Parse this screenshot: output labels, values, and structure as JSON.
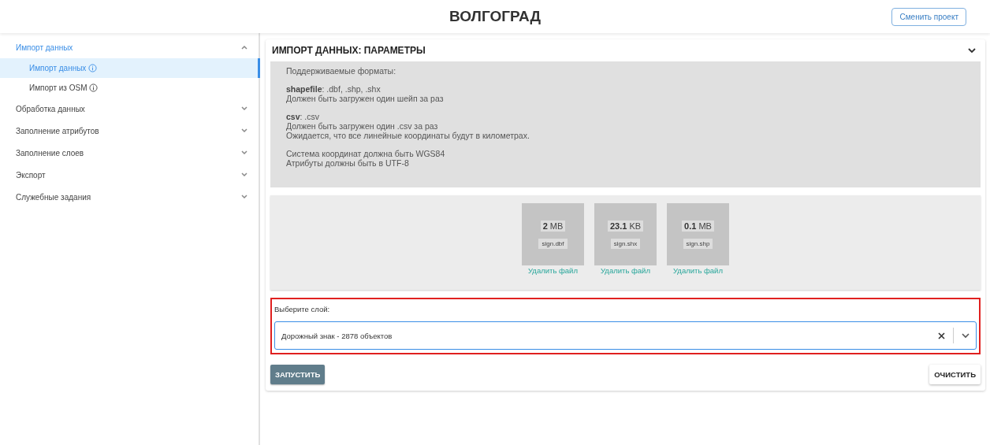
{
  "header": {
    "title": "ВОЛГОГРАД",
    "button": "Сменить проект"
  },
  "sidebar": {
    "groups": [
      {
        "label": "Импорт данных",
        "expanded": true,
        "children": [
          {
            "label": "Импорт данных",
            "selected": true
          },
          {
            "label": "Импорт из OSM",
            "selected": false
          }
        ]
      },
      {
        "label": "Обработка данных",
        "expanded": false
      },
      {
        "label": "Заполнение атрибутов",
        "expanded": false
      },
      {
        "label": "Заполнение слоев",
        "expanded": false
      },
      {
        "label": "Экспорт",
        "expanded": false
      },
      {
        "label": "Служебные задания",
        "expanded": false
      }
    ]
  },
  "panel": {
    "title": "ИМПОРТ ДАННЫХ: ПАРАМЕТРЫ",
    "expanded": true,
    "info": [
      [
        "Поддерживаемые форматы:"
      ],
      [
        "**shapefile**: .dbf, .shp, .shx",
        "Должен быть загружен один шейп за раз"
      ],
      [
        "**csv**: .csv",
        "Должен быть загружен один .csv за раз",
        "Ожидается, что все линейные координаты будут в километрах."
      ],
      [
        "Система координат должна быть WGS84",
        "Атрибуты должны быть в UTF-8"
      ]
    ],
    "files": [
      {
        "size": "2",
        "unit": "MB",
        "name": "sign.dbf",
        "remove": "Удалить файл"
      },
      {
        "size": "23.1",
        "unit": "KB",
        "name": "sign.shx",
        "remove": "Удалить файл"
      },
      {
        "size": "0.1",
        "unit": "MB",
        "name": "sign.shp",
        "remove": "Удалить файл"
      }
    ],
    "layer": {
      "label": "Выберите слой:",
      "value": "Дорожный знак - 2878 объектов",
      "highlighted": true
    },
    "run_button": "ЗАПУСТИТЬ",
    "clear_button": "ОЧИСТИТЬ"
  }
}
